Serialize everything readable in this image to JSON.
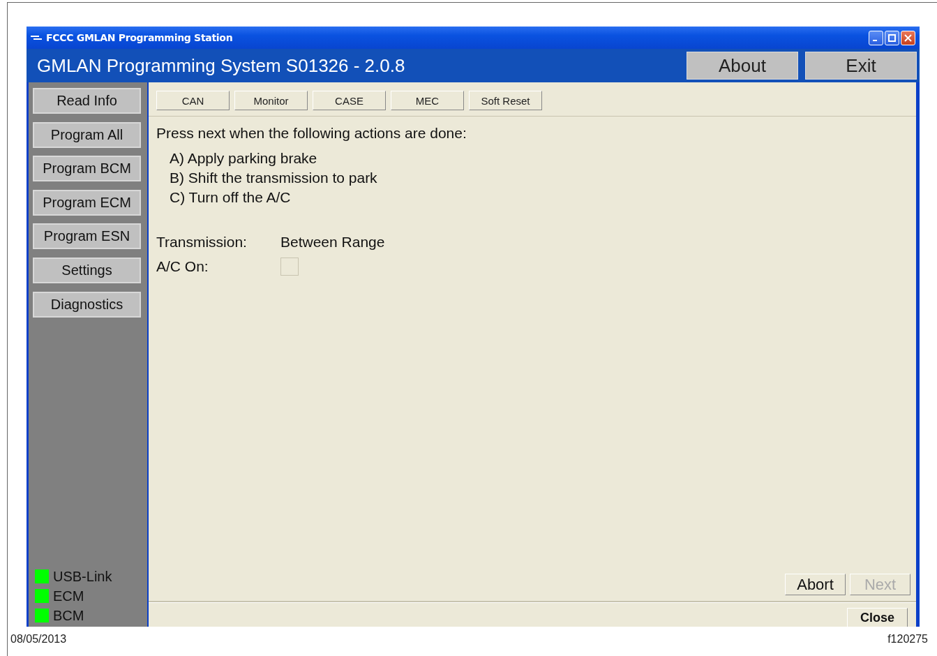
{
  "window": {
    "title": "FCCC GMLAN Programming Station"
  },
  "header": {
    "title": "GMLAN Programming System S01326 - 2.0.8",
    "buttons": [
      "About",
      "Exit"
    ]
  },
  "sidebar": {
    "buttons": [
      "Read Info",
      "Program All",
      "Program BCM",
      "Program ECM",
      "Program ESN",
      "Settings",
      "Diagnostics"
    ],
    "indicators": [
      {
        "label": "USB-Link",
        "on": true
      },
      {
        "label": "ECM",
        "on": true
      },
      {
        "label": "BCM",
        "on": true
      }
    ]
  },
  "toolbar": [
    "CAN",
    "Monitor",
    "CASE",
    "MEC",
    "Soft Reset"
  ],
  "instructions": {
    "heading": "Press next when the following actions are done:",
    "steps": [
      "A) Apply parking brake",
      "B) Shift the transmission to park",
      "C) Turn off the A/C"
    ]
  },
  "status": {
    "transmission_label": "Transmission:",
    "transmission_value": "Between Range",
    "ac_label": "A/C On:",
    "ac_checked": false
  },
  "actions": [
    {
      "label": "Abort",
      "disabled": false
    },
    {
      "label": "Next",
      "disabled": true
    }
  ],
  "close_button": "Close",
  "footer": {
    "date": "08/05/2013",
    "figure_id": "f120275"
  }
}
